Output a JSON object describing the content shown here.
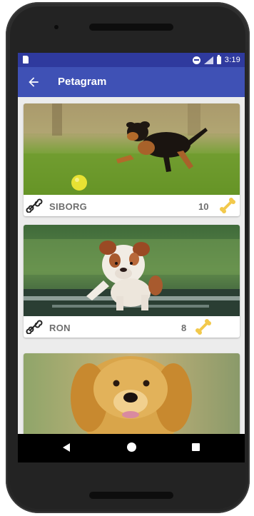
{
  "status_bar": {
    "time": "3:19",
    "icons": [
      "sd-card-icon",
      "do-not-disturb-icon",
      "signal-icon",
      "battery-icon"
    ]
  },
  "app_bar": {
    "title": "Petagram",
    "back_icon": "arrow-back-icon"
  },
  "pets": [
    {
      "name": "SIBORG",
      "likes": "10",
      "photo": "rottweiler-puppy-running-on-grass",
      "icon_left": "bone-outline-icon",
      "icon_right": "bone-gold-icon"
    },
    {
      "name": "RON",
      "likes": "8",
      "photo": "bulldog-puppy-in-water",
      "icon_left": "bone-outline-icon",
      "icon_right": "bone-gold-icon"
    },
    {
      "name": "",
      "likes": "",
      "photo": "golden-retriever-puppy"
    }
  ],
  "nav_bar": {
    "back": "nav-back-icon",
    "home": "nav-home-icon",
    "recents": "nav-recents-icon"
  },
  "colors": {
    "primary": "#3f51b5",
    "primary_dark": "#2f3a9e",
    "bone_gold": "#f2c94c",
    "text_secondary": "#6e6e6e"
  }
}
